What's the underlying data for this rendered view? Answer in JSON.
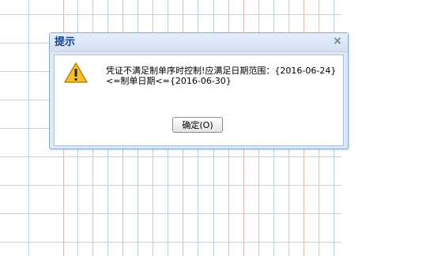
{
  "dialog": {
    "title": "提示",
    "close_symbol": "×",
    "icon": "warning-icon",
    "message": "凭证不满足制单序时控制!应满足日期范围：{2016-06-24}<=制单日期<={2016-06-30}",
    "ok_button_label": "确定(O)"
  },
  "colors": {
    "title_text": "#15428b",
    "dialog_background": "#dfe8f6",
    "grid_blue": "#b9cfe6",
    "grid_red": "#e8b8b0",
    "warning_fill": "#f6c02c"
  }
}
